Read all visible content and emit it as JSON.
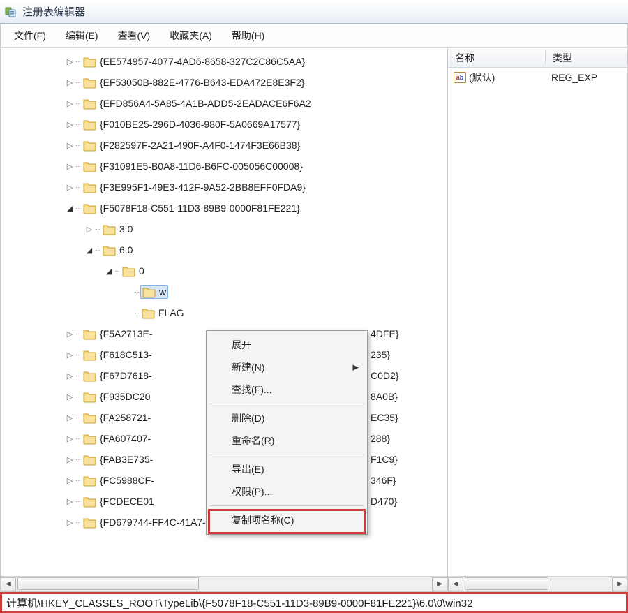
{
  "window": {
    "title": "注册表编辑器"
  },
  "menu": {
    "file": "文件(F)",
    "edit": "编辑(E)",
    "view": "查看(V)",
    "favorites": "收藏夹(A)",
    "help": "帮助(H)"
  },
  "tree": {
    "items": [
      {
        "depth": 3,
        "expand": "closed",
        "label": "{EE574957-4077-4AD6-8658-327C2C86C5AA}"
      },
      {
        "depth": 3,
        "expand": "closed",
        "label": "{EF53050B-882E-4776-B643-EDA472E8E3F2}"
      },
      {
        "depth": 3,
        "expand": "closed",
        "label": "{EFD856A4-5A85-4A1B-ADD5-2EADACE6F6A2"
      },
      {
        "depth": 3,
        "expand": "closed",
        "label": "{F010BE25-296D-4036-980F-5A0669A17577}"
      },
      {
        "depth": 3,
        "expand": "closed",
        "label": "{F282597F-2A21-490F-A4F0-1474F3E66B38}"
      },
      {
        "depth": 3,
        "expand": "closed",
        "label": "{F31091E5-B0A8-11D6-B6FC-005056C00008}"
      },
      {
        "depth": 3,
        "expand": "closed",
        "label": "{F3E995F1-49E3-412F-9A52-2BB8EFF0FDA9}"
      },
      {
        "depth": 3,
        "expand": "open",
        "label": "{F5078F18-C551-11D3-89B9-0000F81FE221}"
      },
      {
        "depth": 4,
        "expand": "closed",
        "label": "3.0"
      },
      {
        "depth": 4,
        "expand": "open",
        "label": "6.0"
      },
      {
        "depth": 5,
        "expand": "open",
        "label": "0"
      },
      {
        "depth": 6,
        "expand": "none",
        "label": "w",
        "selected": true
      },
      {
        "depth": 6,
        "expand": "none",
        "label": "FLAG"
      },
      {
        "depth": 3,
        "expand": "closed",
        "label": "{F5A2713E-",
        "tail": "4DFE}"
      },
      {
        "depth": 3,
        "expand": "closed",
        "label": "{F618C513-",
        "tail": "235}"
      },
      {
        "depth": 3,
        "expand": "closed",
        "label": "{F67D7618-",
        "tail": "C0D2}"
      },
      {
        "depth": 3,
        "expand": "closed",
        "label": "{F935DC20",
        "tail": "8A0B}"
      },
      {
        "depth": 3,
        "expand": "closed",
        "label": "{FA258721-",
        "tail": "EC35}"
      },
      {
        "depth": 3,
        "expand": "closed",
        "label": "{FA607407-",
        "tail": "288}"
      },
      {
        "depth": 3,
        "expand": "closed",
        "label": "{FAB3E735-",
        "tail": "F1C9}"
      },
      {
        "depth": 3,
        "expand": "closed",
        "label": "{FC5988CF-",
        "tail": "346F}"
      },
      {
        "depth": 3,
        "expand": "closed",
        "label": "{FCDECE01",
        "tail": "D470}"
      },
      {
        "depth": 3,
        "expand": "closed",
        "label": "{FD679744-FF4C-41A7-B800-0F8A2ED710C6}"
      }
    ]
  },
  "list": {
    "header_name": "名称",
    "header_type": "类型",
    "rows": [
      {
        "name": "(默认)",
        "type": "REG_EXP"
      }
    ]
  },
  "context_menu": {
    "expand": "展开",
    "new": "新建(N)",
    "find": "查找(F)...",
    "delete": "删除(D)",
    "rename": "重命名(R)",
    "export": "导出(E)",
    "permissions": "权限(P)...",
    "copy_key_name": "复制项名称(C)"
  },
  "statusbar": {
    "path": "计算机\\HKEY_CLASSES_ROOT\\TypeLib\\{F5078F18-C551-11D3-89B9-0000F81FE221}\\6.0\\0\\win32"
  }
}
